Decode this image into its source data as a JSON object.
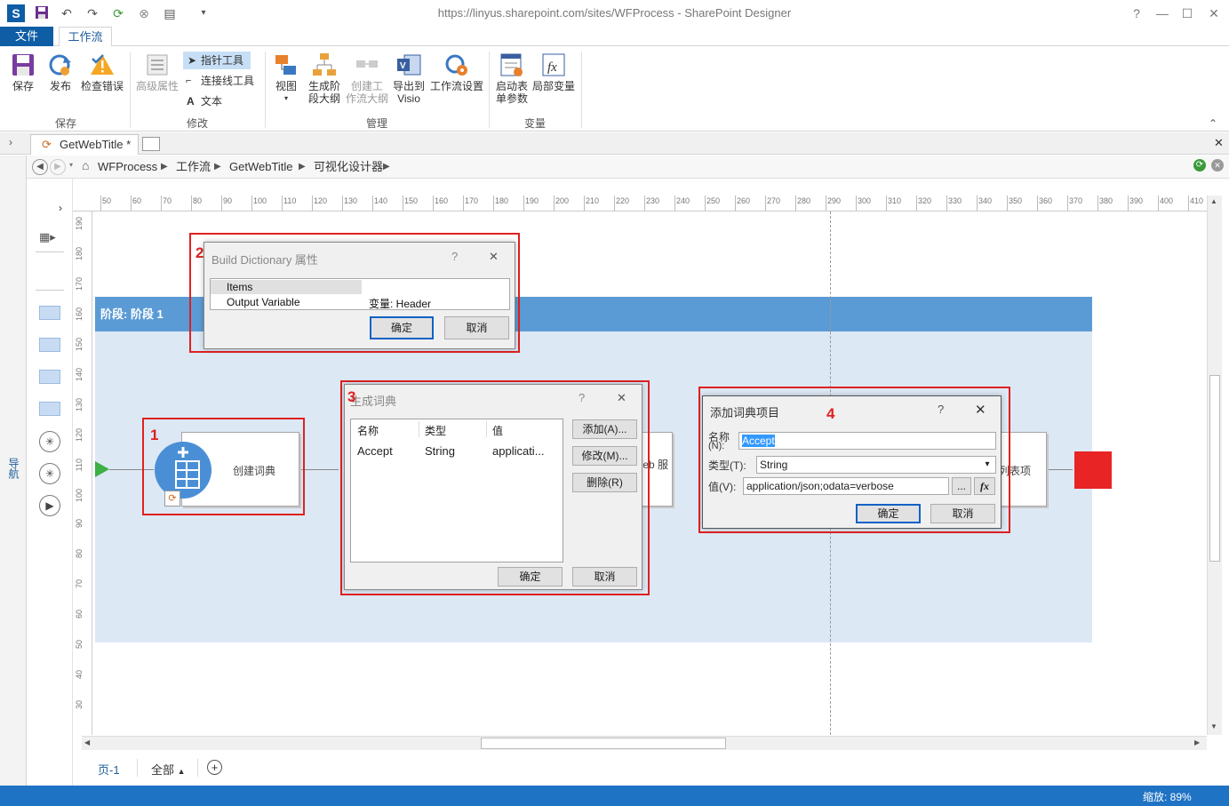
{
  "window": {
    "title": "https://linyus.sharepoint.com/sites/WFProcess - SharePoint Designer",
    "help": "?",
    "minimize": "—",
    "maximize": "☐",
    "close": "✕"
  },
  "ribbon": {
    "tab_file": "文件",
    "tab_workflow": "工作流",
    "groups": {
      "save": "保存",
      "modify": "修改",
      "manage": "管理",
      "variables": "变量"
    },
    "buttons": {
      "save": "保存",
      "publish": "发布",
      "check_errors": "检查错误",
      "advanced_props": "高级属性",
      "pointer_tool": "指针工具",
      "connector_tool": "连接线工具",
      "text_tool": "文本",
      "view": "视图",
      "gen_stage_line1": "生成阶",
      "gen_stage_line2": "段大纲",
      "create_wf_line1": "创建工",
      "create_wf_line2": "作流大纲",
      "export_line1": "导出到",
      "export_line2": "Visio",
      "wf_settings": "工作流设置",
      "init_form_line1": "启动表",
      "init_form_line2": "单参数",
      "local_vars": "局部变量"
    }
  },
  "doc_tab": {
    "label": "GetWebTitle *"
  },
  "breadcrumb": [
    "WFProcess",
    "工作流",
    "GetWebTitle",
    "可视化设计器"
  ],
  "nav_pane_label": "导航",
  "ruler": {
    "h_ticks": [
      "50",
      "60",
      "70",
      "80",
      "90",
      "100",
      "110",
      "120",
      "130",
      "140",
      "150",
      "160",
      "170",
      "180",
      "190",
      "200",
      "210",
      "220",
      "230",
      "240",
      "250",
      "260",
      "270",
      "280",
      "290",
      "300",
      "310",
      "320",
      "330",
      "340",
      "350",
      "360",
      "370",
      "380",
      "390",
      "400",
      "410"
    ],
    "v_ticks": [
      "190",
      "180",
      "170",
      "160",
      "150",
      "140",
      "130",
      "120",
      "110",
      "100",
      "90",
      "80",
      "70",
      "60",
      "50",
      "40",
      "30"
    ]
  },
  "stage": {
    "header": "阶段:  阶段 1"
  },
  "shapes": {
    "create_dictionary": "创建词典",
    "web_service_partial": "/eb 服",
    "list_item_partial": "列表项"
  },
  "markers": {
    "m1": "1",
    "m2": "2",
    "m3": "3",
    "m4": "4"
  },
  "dialog_props": {
    "title": "Build Dictionary 属性",
    "help": "?",
    "close": "✕",
    "rows": [
      {
        "name": "Items",
        "value": ""
      },
      {
        "name": "Output Variable",
        "value": "变量: Header"
      }
    ],
    "ok": "确定",
    "cancel": "取消"
  },
  "dialog_dict": {
    "title": "生成词典",
    "help": "?",
    "close": "✕",
    "columns": [
      "名称",
      "类型",
      "值"
    ],
    "rows": [
      {
        "name": "Accept",
        "type": "String",
        "value": "applicati..."
      }
    ],
    "add": "添加(A)...",
    "modify": "修改(M)...",
    "delete": "删除(R)",
    "ok": "确定",
    "cancel": "取消"
  },
  "dialog_add_item": {
    "title": "添加词典项目",
    "help": "?",
    "close": "✕",
    "name_label_1": "名称",
    "name_label_2": "(N):",
    "name_value": "Accept",
    "type_label": "类型(T):",
    "type_value": "String",
    "value_label": "值(V):",
    "value_value": "application/json;odata=verbose",
    "ellipsis": "...",
    "fx": "fx",
    "ok": "确定",
    "cancel": "取消"
  },
  "pagebar": {
    "page": "页-1",
    "all": "全部"
  },
  "status": {
    "zoom": "缩放: 89%"
  },
  "colors": {
    "accent": "#1f73c4",
    "stage_header": "#5b9bd5",
    "stage_bg": "#dde8f5",
    "marker_red": "#e02020",
    "start_green": "#3cb043",
    "end_red": "#e82424"
  }
}
